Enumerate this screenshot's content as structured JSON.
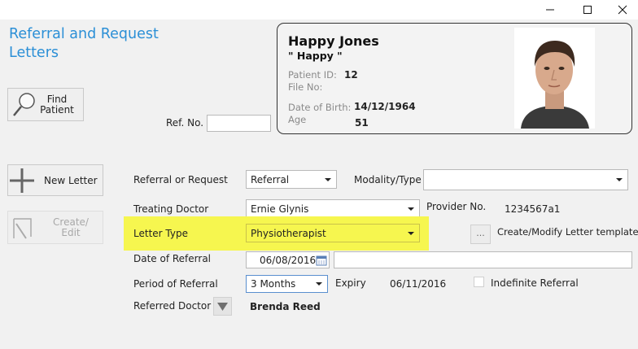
{
  "window": {
    "minimize": "minimize",
    "maximize": "maximize",
    "close": "close"
  },
  "app": {
    "title_line1": "Referral and Request",
    "title_line2": "Letters"
  },
  "sidebar": {
    "find_patient": {
      "line1": "Find",
      "line2": "Patient"
    },
    "new_letter": "New Letter",
    "create_edit": {
      "line1": "Create/",
      "line2": "Edit"
    }
  },
  "ref_no": {
    "label": "Ref. No.",
    "value": ""
  },
  "patient": {
    "name": "Happy Jones",
    "nickname": "\" Happy \"",
    "patient_id_label": "Patient ID:",
    "patient_id": "12",
    "file_no_label": "File No:",
    "file_no": "",
    "dob_label": "Date of Birth:",
    "dob": "14/12/1964",
    "age_label": "Age",
    "age": "51"
  },
  "form": {
    "referral_or_request": {
      "label": "Referral or Request",
      "value": "Referral"
    },
    "modality_type": {
      "label": "Modality/Type",
      "value": ""
    },
    "treating_doctor": {
      "label": "Treating Doctor",
      "value": "Ernie Glynis"
    },
    "provider_no": {
      "label": "Provider No.",
      "value": "1234567a1"
    },
    "letter_type": {
      "label": "Letter Type",
      "value": "Physiotherapist"
    },
    "templates": {
      "button": "...",
      "label": "Create/Modify Letter templates"
    },
    "date_of_referral": {
      "label": "Date of Referral",
      "value": "06/08/2016",
      "note": ""
    },
    "period_of_referral": {
      "label": "Period of Referral",
      "value": "3 Months"
    },
    "expiry": {
      "label": "Expiry",
      "value": "06/11/2016"
    },
    "indefinite": {
      "label": "Indefinite Referral",
      "checked": false
    },
    "referred_doctor": {
      "label": "Referred Doctor",
      "value": "Brenda Reed"
    }
  },
  "colors": {
    "accent": "#2b8fd6",
    "highlight": "#f6f64f",
    "background": "#f1f1f1"
  }
}
